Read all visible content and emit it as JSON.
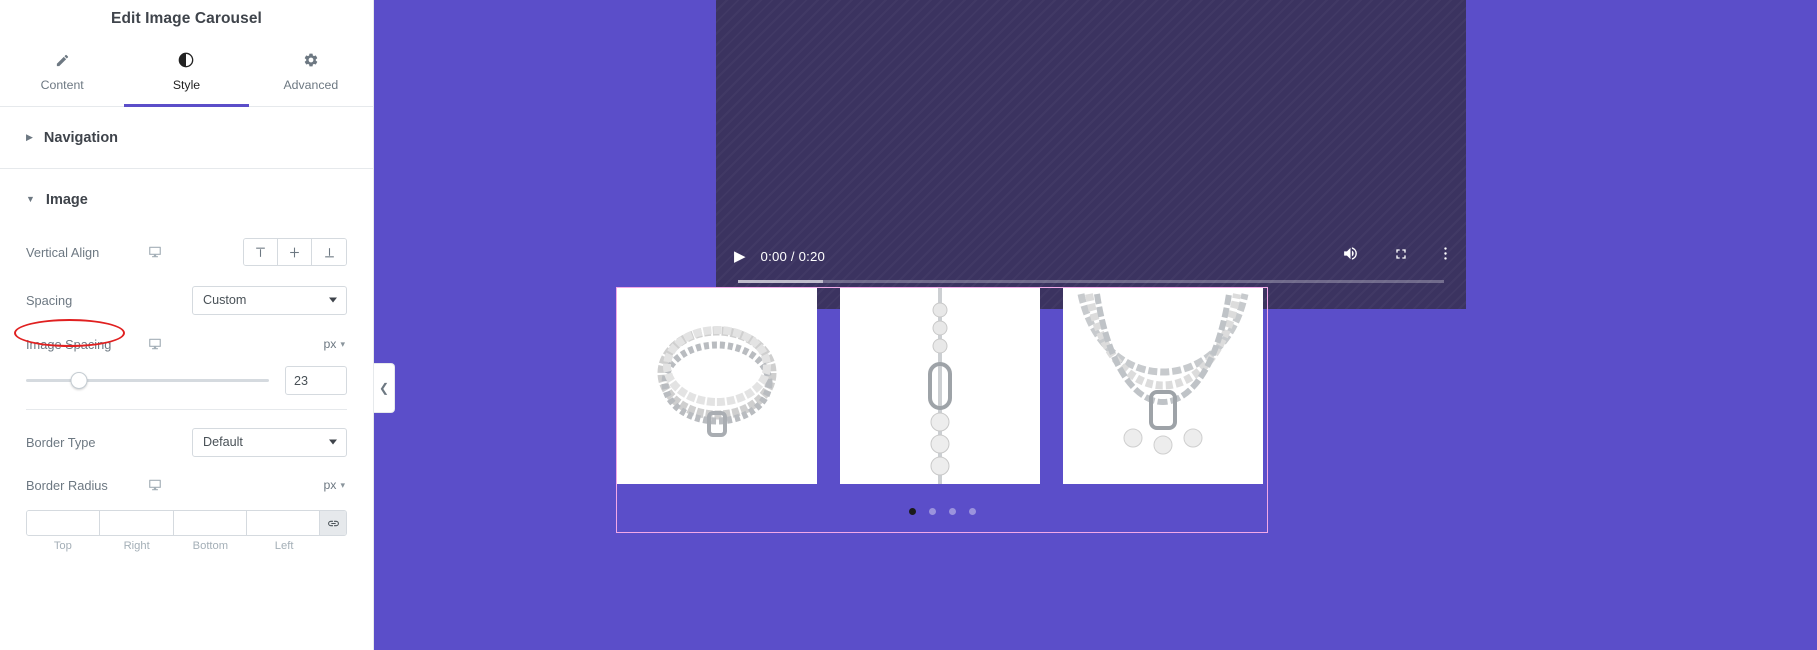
{
  "panel": {
    "title": "Edit Image Carousel",
    "tabs": [
      {
        "label": "Content",
        "icon": "pencil-icon",
        "active": false
      },
      {
        "label": "Style",
        "icon": "contrast-icon",
        "active": true
      },
      {
        "label": "Advanced",
        "icon": "gear-icon",
        "active": false
      }
    ],
    "sections": [
      {
        "label": "Navigation",
        "expanded": false
      },
      {
        "label": "Image",
        "expanded": true
      }
    ],
    "controls": {
      "vertical_align": {
        "label": "Vertical Align",
        "device_icon": "desktop-icon",
        "options": [
          {
            "name": "align-top",
            "glyph": "⊤"
          },
          {
            "name": "align-middle",
            "glyph": "‡"
          },
          {
            "name": "align-bottom",
            "glyph": "⊥"
          }
        ]
      },
      "spacing": {
        "label": "Spacing",
        "value": "Custom"
      },
      "image_spacing": {
        "label": "Image Spacing",
        "device_icon": "desktop-icon",
        "unit": "px",
        "value": "23",
        "slider_percent": 22
      },
      "border_type": {
        "label": "Border Type",
        "value": "Default"
      },
      "border_radius": {
        "label": "Border Radius",
        "device_icon": "desktop-icon",
        "unit": "px",
        "fields": [
          {
            "label": "Top",
            "value": ""
          },
          {
            "label": "Right",
            "value": ""
          },
          {
            "label": "Bottom",
            "value": ""
          },
          {
            "label": "Left",
            "value": ""
          }
        ],
        "link_icon": "link-icon"
      }
    },
    "annotation": {
      "target": "Image Spacing",
      "color": "#e02020"
    }
  },
  "preview": {
    "collapse_handle_icon": "chevron-left-icon",
    "video": {
      "play_icon": "play-icon",
      "time": "0:00 / 0:20",
      "volume_icon": "volume-icon",
      "fullscreen_icon": "fullscreen-icon",
      "menu_icon": "kebab-menu-icon",
      "progress_percent": 12
    },
    "carousel": {
      "prev_icon": "chevron-left-icon",
      "next_icon": "chevron-right-icon",
      "slides": [
        {
          "name": "pearl-chain-bracelet"
        },
        {
          "name": "pearl-link-necklace"
        },
        {
          "name": "double-strand-pearl-chain-necklace"
        }
      ],
      "dots": [
        {
          "active": true
        },
        {
          "active": false
        },
        {
          "active": false
        },
        {
          "active": false
        }
      ]
    }
  },
  "colors": {
    "accent": "#5b4ec9",
    "panel_bg": "#ffffff",
    "carousel_outline": "#f2a8e8",
    "annotation": "#e02020"
  }
}
